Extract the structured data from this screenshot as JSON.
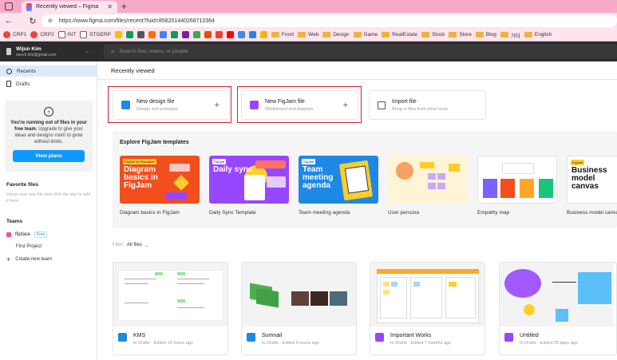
{
  "browser": {
    "tab_title": "Recently viewed – Figma",
    "url": "https://www.figma.com/files/recent?fuid=858201440268710364",
    "bookmarks": [
      {
        "label": "CRP1",
        "kind": "site",
        "color": "#e8453c"
      },
      {
        "label": "CRP2",
        "kind": "site",
        "color": "#e8453c"
      },
      {
        "label": "INT",
        "kind": "page",
        "color": "#666666"
      },
      {
        "label": "STGERP",
        "kind": "page",
        "color": "#666666"
      },
      {
        "label": "Front",
        "kind": "folder"
      },
      {
        "label": "Web",
        "kind": "folder"
      },
      {
        "label": "Design",
        "kind": "folder"
      },
      {
        "label": "Game",
        "kind": "folder"
      },
      {
        "label": "RealEstate",
        "kind": "folder"
      },
      {
        "label": "Stock",
        "kind": "folder"
      },
      {
        "label": "Store",
        "kind": "folder"
      },
      {
        "label": "Blog",
        "kind": "folder"
      },
      {
        "label": "기타",
        "kind": "folder"
      },
      {
        "label": "English",
        "kind": "folder"
      }
    ],
    "bookmark_icon_colors": [
      "#f4c20d",
      "#0f9d58",
      "#555555",
      "#ff6d00",
      "#4285f4",
      "#0f9d58",
      "#7b1fa2",
      "#34a853",
      "#e65100",
      "#ea4335",
      "#ff0000",
      "#4285f4",
      "#1e88e5",
      "#f4b400"
    ]
  },
  "account": {
    "name": "Wijun Kim",
    "email": "seech.kim@gmail.com"
  },
  "search": {
    "placeholder": "Search files, teams, or people"
  },
  "sidebar": {
    "recents_label": "Recents",
    "drafts_label": "Drafts",
    "upgrade_title": "You're running out of files in your free team.",
    "upgrade_body": "Upgrade to give your ideas and designs room to grow without limits.",
    "upgrade_button": "View plans",
    "favorites_heading": "Favorite files",
    "favorites_hint": "Hover over any file and click the star to add it here",
    "teams_heading": "Teams",
    "team_name": "flipface",
    "team_badge": "Free",
    "project_name": "First Project",
    "create_team": "Create new team"
  },
  "main": {
    "heading": "Recently viewed",
    "new_design": {
      "title": "New design file",
      "subtitle": "Design and prototype"
    },
    "new_figjam": {
      "title": "New FigJam file",
      "subtitle": "Whiteboard and diagram"
    },
    "import": {
      "title": "Import file",
      "subtitle": "Bring in files from other tools"
    },
    "templates_heading": "Explore FigJam templates",
    "templates": [
      {
        "caption": "Diagram basics in FigJam",
        "art": "Diagram basics in FigJam",
        "tag": "FigJam for Education",
        "bg": "#f24e1e"
      },
      {
        "caption": "Daily Sync Template",
        "art": "Daily sync",
        "tag": "FigJam",
        "bg": "#9747ff"
      },
      {
        "caption": "Team meeting agenda",
        "art": "Team meeting agenda",
        "tag": "FigJam",
        "bg": "#1e88e5"
      },
      {
        "caption": "User persona",
        "art": "",
        "tag": "",
        "bg": "#fff4d6"
      },
      {
        "caption": "Empathy map",
        "art": "",
        "tag": "",
        "bg": "#ffffff"
      },
      {
        "caption": "Business model canvas",
        "art": "Business model canvas",
        "tag": "FigJam",
        "bg": "#ffffff"
      }
    ],
    "filter_label": "Filter:",
    "filter_value": "All files",
    "files": [
      {
        "name": "KMS",
        "meta": "In Drafts · Edited 15 hours ago",
        "kind": "design",
        "icon_color": "#1e88e5"
      },
      {
        "name": "Sumnail",
        "meta": "In Drafts · Edited 9 hours ago",
        "kind": "design",
        "icon_color": "#1e88e5"
      },
      {
        "name": "Important Works",
        "meta": "In Drafts · Edited 7 months ago",
        "kind": "figjam",
        "icon_color": "#9747ff"
      },
      {
        "name": "Untitled",
        "meta": "In Drafts · Edited 25 days ago",
        "kind": "figjam",
        "icon_color": "#9747ff"
      }
    ]
  }
}
